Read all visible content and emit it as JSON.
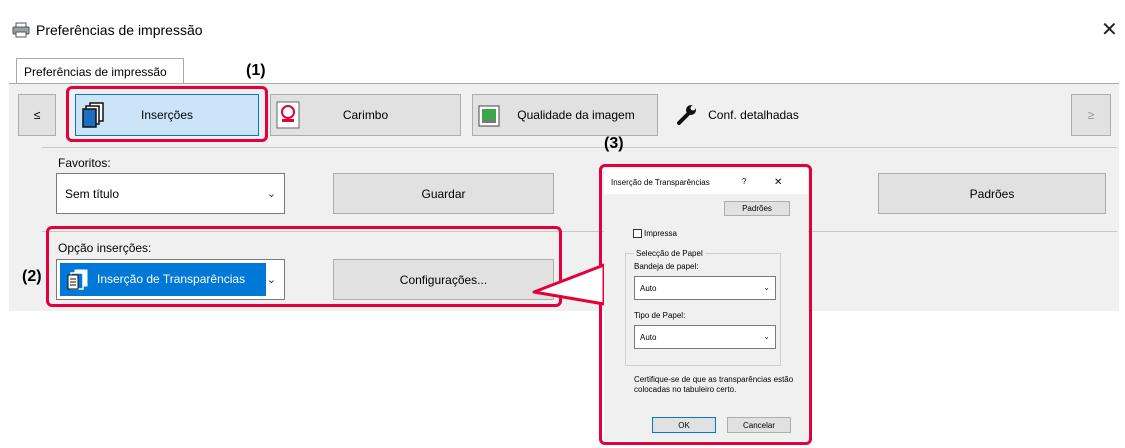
{
  "window": {
    "title": "Preferências de impressão",
    "close_glyph": "✕"
  },
  "tabs": [
    {
      "label": "Preferências de impressão"
    }
  ],
  "toolbar": {
    "prev": "≤",
    "next": "≥",
    "items": [
      {
        "label": "Inserções",
        "icon": "pages-icon"
      },
      {
        "label": "Carimbo",
        "icon": "stamp-icon"
      },
      {
        "label": "Qualidade da imagem",
        "icon": "image-quality-icon"
      },
      {
        "label": "Conf. detalhadas",
        "icon": "wrench-icon"
      }
    ]
  },
  "favorites": {
    "label": "Favoritos:",
    "value": "Sem título",
    "save": "Guardar",
    "defaults": "Padrões"
  },
  "insert_options": {
    "label": "Opção inserções:",
    "value": "Inserção de Transparências",
    "settings": "Configurações..."
  },
  "callouts": {
    "c1": "(1)",
    "c2": "(2)",
    "c3": "(3)"
  },
  "dialog": {
    "title": "Inserção de Transparências",
    "help": "?",
    "close": "✕",
    "defaults": "Padrões",
    "print_checkbox": "Impressa",
    "group_title": "Selecção de Papel",
    "tray_label": "Bandeja de papel:",
    "tray_value": "Auto",
    "type_label": "Tipo de Papel:",
    "type_value": "Auto",
    "note": "Certifique-se de que as transparências estão colocadas no tabuleiro certo.",
    "ok": "OK",
    "cancel": "Cancelar"
  },
  "colors": {
    "accent": "#e4003a",
    "selection": "#0078d7",
    "panel": "#f0f0f0"
  }
}
